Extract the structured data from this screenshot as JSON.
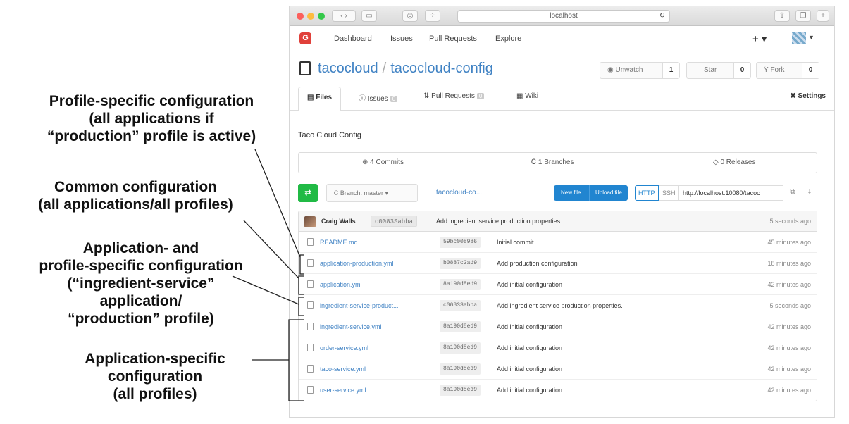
{
  "annotations": {
    "profile_specific": [
      "Profile-specific configuration",
      "(all applications if",
      "“production” profile is active)"
    ],
    "common": [
      "Common configuration",
      "(all applications/all profiles)"
    ],
    "app_and_profile": [
      "Application- and",
      "profile-specific configuration",
      "(“ingredient-service”",
      "application/",
      "“production” profile)"
    ],
    "app_specific": [
      "Application-specific",
      "configuration",
      "(all profiles)"
    ]
  },
  "browser": {
    "url": "localhost"
  },
  "navbar": {
    "logo": "G",
    "links": [
      "Dashboard",
      "Issues",
      "Pull Requests",
      "Explore"
    ],
    "plus": "+ ▾"
  },
  "repo": {
    "owner": "tacocloud",
    "separator": "/",
    "name": "tacocloud-config",
    "unwatch_label": "◉ Unwatch",
    "unwatch_count": "1",
    "star_label": "Star",
    "star_count": "0",
    "fork_label": "Ŷ Fork",
    "fork_count": "0"
  },
  "tabs": {
    "files": "Files",
    "issues": "Issues",
    "pull_requests": "Pull Requests",
    "wiki": "Wiki",
    "settings": "Settings",
    "issues_badge": "0",
    "pulls_badge": "0"
  },
  "description": "Taco Cloud Config",
  "stats": {
    "commits": "4 Commits",
    "branches": "1 Branches",
    "releases": "0 Releases"
  },
  "actions": {
    "branch": "Branch: master ▾",
    "path": "tacocloud-co...",
    "new_file": "New file",
    "upload_file": "Upload file",
    "http": "HTTP",
    "ssh": "SSH",
    "clone_url": "http://localhost:10080/tacoc"
  },
  "latest_commit": {
    "author": "Craig Walls",
    "sha": "c0083Sabba",
    "message": "Add ingredient service production properties.",
    "time": "5 seconds ago"
  },
  "files": [
    {
      "name": "README.md",
      "sha": "59bc008986",
      "message": "Initial commit",
      "time": "45 minutes ago"
    },
    {
      "name": "application-production.yml",
      "sha": "b0887c2ad9",
      "message": "Add production configuration",
      "time": "18 minutes ago"
    },
    {
      "name": "application.yml",
      "sha": "8a190d8ed9",
      "message": "Add initial configuration",
      "time": "42 minutes ago"
    },
    {
      "name": "ingredient-service-product...",
      "sha": "c0083Sabba",
      "message": "Add ingredient service production properties.",
      "time": "5 seconds ago"
    },
    {
      "name": "ingredient-service.yml",
      "sha": "8a190d8ed9",
      "message": "Add initial configuration",
      "time": "42 minutes ago"
    },
    {
      "name": "order-service.yml",
      "sha": "8a190d8ed9",
      "message": "Add initial configuration",
      "time": "42 minutes ago"
    },
    {
      "name": "taco-service.yml",
      "sha": "8a190d8ed9",
      "message": "Add initial configuration",
      "time": "42 minutes ago"
    },
    {
      "name": "user-service.yml",
      "sha": "8a190d8ed9",
      "message": "Add initial configuration",
      "time": "42 minutes ago"
    }
  ]
}
